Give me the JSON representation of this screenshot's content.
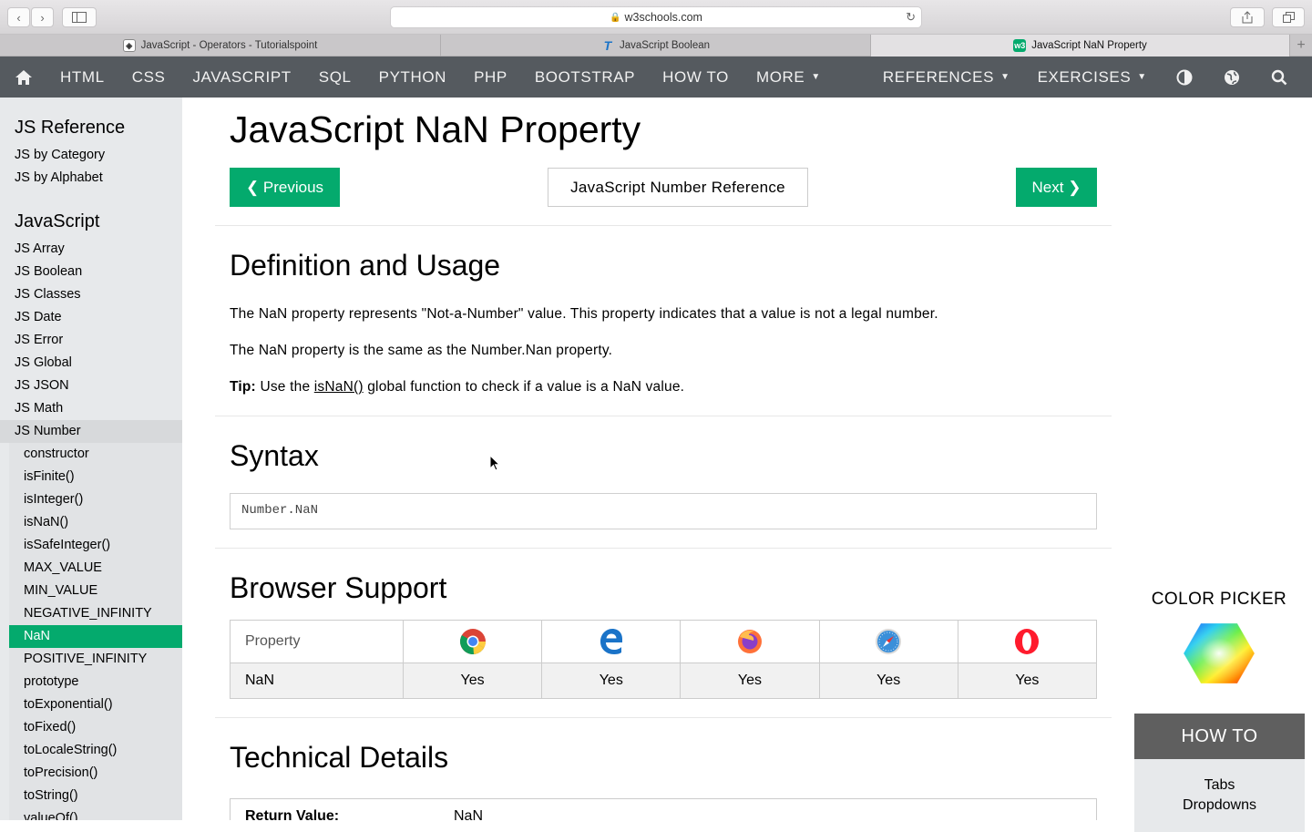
{
  "browser": {
    "url": "w3schools.com",
    "tabs": [
      {
        "title": "JavaScript - Operators - Tutorialspoint",
        "active": false
      },
      {
        "title": "JavaScript Boolean",
        "active": false
      },
      {
        "title": "JavaScript NaN Property",
        "active": true
      }
    ],
    "new_tab": "+"
  },
  "nav": {
    "items": [
      "HTML",
      "CSS",
      "JAVASCRIPT",
      "SQL",
      "PYTHON",
      "PHP",
      "BOOTSTRAP",
      "HOW TO",
      "MORE",
      "REFERENCES",
      "EXERCISES"
    ],
    "bg_color": "#555a5f"
  },
  "sidebar": {
    "ref_heading": "JS Reference",
    "ref_links": [
      "JS by Category",
      "JS by Alphabet"
    ],
    "js_heading": "JavaScript",
    "js_links": [
      "JS Array",
      "JS Boolean",
      "JS Classes",
      "JS Date",
      "JS Error",
      "JS Global",
      "JS JSON",
      "JS Math",
      "JS Number"
    ],
    "number_sub": [
      "constructor",
      "isFinite()",
      "isInteger()",
      "isNaN()",
      "isSafeInteger()",
      "MAX_VALUE",
      "MIN_VALUE",
      "NEGATIVE_INFINITY",
      "NaN",
      "POSITIVE_INFINITY",
      "prototype",
      "toExponential()",
      "toFixed()",
      "toLocaleString()",
      "toPrecision()",
      "toString()",
      "valueOf()"
    ],
    "active_item": "NaN",
    "accent": "#04aa6d"
  },
  "main": {
    "title": "JavaScript NaN Property",
    "prev_label": "❮ Previous",
    "ref_label": "JavaScript Number Reference",
    "next_label": "Next ❯",
    "definition": {
      "heading": "Definition and Usage",
      "p1": "The NaN property represents \"Not-a-Number\" value. This property indicates that a value is not a legal number.",
      "p2": "The NaN property is the same as the Number.Nan property.",
      "tip_label": "Tip:",
      "tip_before": " Use the ",
      "tip_link": "isNaN()",
      "tip_after": " global function to check if a value is a NaN value."
    },
    "syntax": {
      "heading": "Syntax",
      "code": "Number.NaN"
    },
    "support": {
      "heading": "Browser Support",
      "header": "Property",
      "browsers": [
        "chrome-icon",
        "edge-icon",
        "firefox-icon",
        "safari-icon",
        "opera-icon"
      ],
      "row_label": "NaN",
      "values": [
        "Yes",
        "Yes",
        "Yes",
        "Yes",
        "Yes"
      ]
    },
    "technical": {
      "heading": "Technical Details",
      "key": "Return Value:",
      "value": "NaN"
    }
  },
  "rail": {
    "color_picker": "COLOR PICKER",
    "howto_title": "HOW TO",
    "howto_links": [
      "Tabs",
      "Dropdowns"
    ]
  }
}
